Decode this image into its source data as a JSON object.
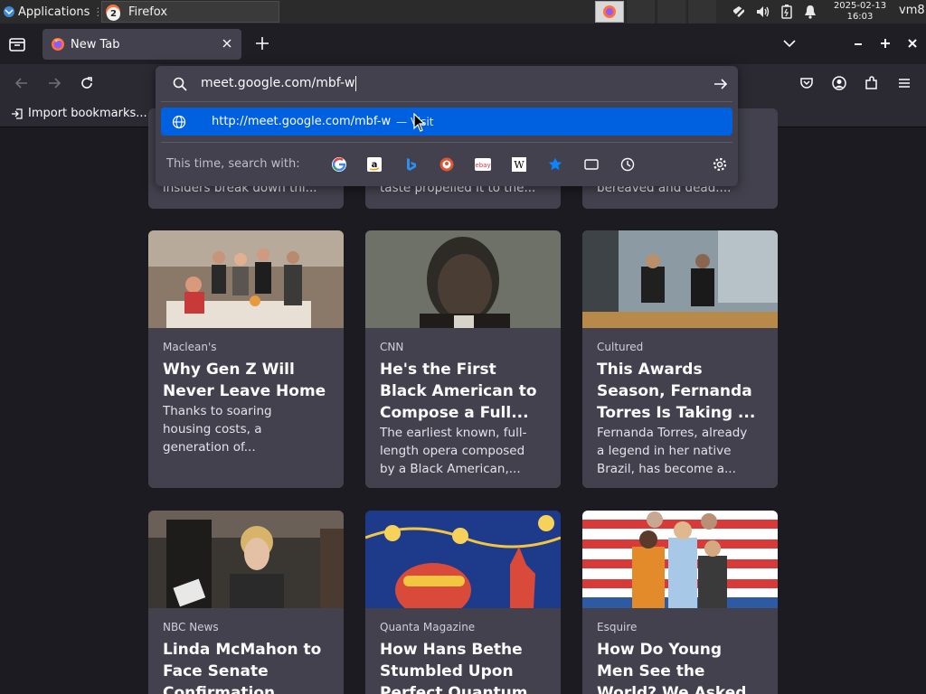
{
  "taskbar": {
    "apps_label": "Applications",
    "task_title": "Firefox",
    "task_badge": "2",
    "clock_date": "2025-02-13",
    "clock_time": "16:03",
    "user": "vm8"
  },
  "browser": {
    "tab_title": "New Tab",
    "url_value": "meet.google.com/mbf-w",
    "suggestion_url": "http://meet.google.com/mbf-w",
    "suggestion_action": "— Visit",
    "search_with_label": "This time, search with:",
    "engines": [
      "google-icon",
      "amazon-icon",
      "bing-icon",
      "duckduckgo-icon",
      "ebay-icon",
      "wikipedia-icon",
      "bookmarks-icon",
      "tabs-icon",
      "history-icon"
    ],
    "bookmarks_import": "Import bookmarks..."
  },
  "top_cards": [
    {
      "excerpt": "insiders break down thi..."
    },
    {
      "excerpt": "taste propelled it to the..."
    },
    {
      "excerpt": "bereaved and dead...."
    }
  ],
  "cards": [
    {
      "source": "Maclean's",
      "title_lines": [
        "Why Gen Z Will",
        "Never Leave Home"
      ],
      "excerpt_lines": [
        "Thanks to soaring",
        "housing costs, a",
        "generation of..."
      ]
    },
    {
      "source": "CNN",
      "title_lines": [
        "He's the First",
        "Black American to",
        "Compose a Full..."
      ],
      "excerpt_lines": [
        "The earliest known, full-",
        "length opera composed",
        "by a Black American,..."
      ]
    },
    {
      "source": "Cultured",
      "title_lines": [
        "This Awards",
        "Season, Fernanda",
        "Torres Is Taking ..."
      ],
      "excerpt_lines": [
        "Fernanda Torres, already",
        "a legend in her native",
        "Brazil, has become a..."
      ]
    },
    {
      "source": "NBC News",
      "title_lines": [
        "Linda McMahon to",
        "Face Senate",
        "Confirmation..."
      ],
      "excerpt_lines": []
    },
    {
      "source": "Quanta Magazine",
      "title_lines": [
        "How Hans Bethe",
        "Stumbled Upon",
        "Perfect Quantum..."
      ],
      "excerpt_lines": []
    },
    {
      "source": "Esquire",
      "title_lines": [
        "How Do Young",
        "Men See the",
        "World? We Asked..."
      ],
      "excerpt_lines": []
    }
  ]
}
